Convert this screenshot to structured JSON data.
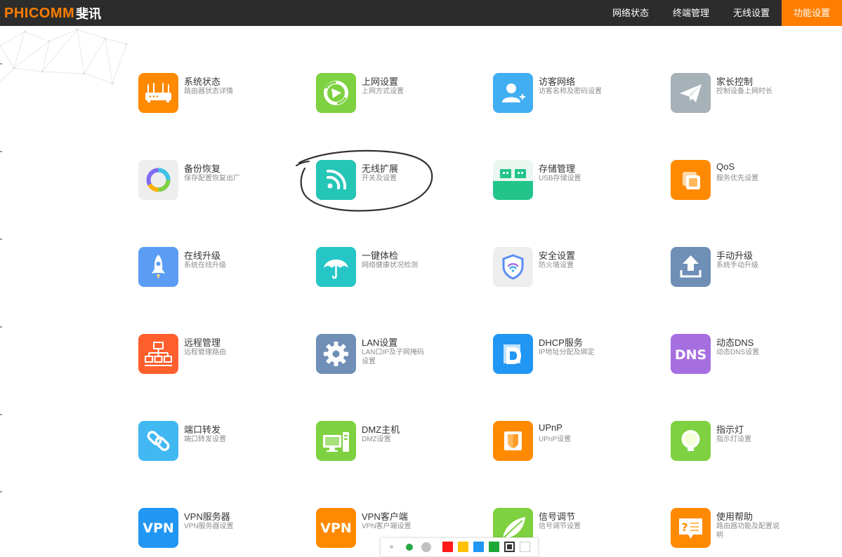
{
  "header": {
    "brand_en": "PHICOMM",
    "brand_cn": "斐讯",
    "nav": [
      {
        "label": "网络状态",
        "active": false
      },
      {
        "label": "终端管理",
        "active": false
      },
      {
        "label": "无线设置",
        "active": false
      },
      {
        "label": "功能设置",
        "active": true
      }
    ]
  },
  "colors": {
    "accent": "#ff7e00",
    "header_bg": "#2c2c2c",
    "annotation": "#333333"
  },
  "features": [
    {
      "title": "系统状态",
      "subtitle": "路由器状态详情",
      "icon": "router-icon",
      "color": "#ff8a00"
    },
    {
      "title": "上网设置",
      "subtitle": "上网方式设置",
      "icon": "internet-icon",
      "color": "#7ed140"
    },
    {
      "title": "访客网络",
      "subtitle": "访客名称及密码设置",
      "icon": "guest-user-icon",
      "color": "#41aef2"
    },
    {
      "title": "家长控制",
      "subtitle": "控制设备上网时长",
      "icon": "paper-plane-icon",
      "color": "#a7b1b8"
    },
    {
      "title": "备份恢复",
      "subtitle": "保存配置恢复出厂",
      "icon": "backup-ring-icon",
      "color": "#eeeeee"
    },
    {
      "title": "无线扩展",
      "subtitle": "开关及设置",
      "icon": "wifi-extend-icon",
      "color": "#26c6b7"
    },
    {
      "title": "存储管理",
      "subtitle": "USB存储设置",
      "icon": "usb-storage-icon",
      "color": "#22c48b"
    },
    {
      "title": "QoS",
      "subtitle": "服务优先设置",
      "icon": "qos-icon",
      "color": "#ff8a00"
    },
    {
      "title": "在线升级",
      "subtitle": "系统在线升级",
      "icon": "rocket-icon",
      "color": "#5b9df5"
    },
    {
      "title": "一键体检",
      "subtitle": "网络健康状况检测",
      "icon": "umbrella-icon",
      "color": "#26c6c6"
    },
    {
      "title": "安全设置",
      "subtitle": "防火墙设置",
      "icon": "shield-icon",
      "color": "#eeeeee"
    },
    {
      "title": "手动升级",
      "subtitle": "系统手动升级",
      "icon": "upload-icon",
      "color": "#6f8fb6"
    },
    {
      "title": "远程管理",
      "subtitle": "远程管理路由",
      "icon": "network-tree-icon",
      "color": "#ff5f2d"
    },
    {
      "title": "LAN设置",
      "subtitle": "LAN口IP及子网掩码设置",
      "icon": "gear-icon",
      "color": "#6f8fb6"
    },
    {
      "title": "DHCP服务",
      "subtitle": "IP地址分配及绑定",
      "icon": "dhcp-icon",
      "color": "#2196f3"
    },
    {
      "title": "动态DNS",
      "subtitle": "动态DNS设置",
      "icon": "dns-icon",
      "color": "#a66fe0"
    },
    {
      "title": "端口转发",
      "subtitle": "端口转发设置",
      "icon": "link-icon",
      "color": "#41b8f2"
    },
    {
      "title": "DMZ主机",
      "subtitle": "DMZ设置",
      "icon": "computer-icon",
      "color": "#7ed140"
    },
    {
      "title": "UPnP",
      "subtitle": "UPnP设置",
      "icon": "upnp-icon",
      "color": "#ff8a00"
    },
    {
      "title": "指示灯",
      "subtitle": "指示灯设置",
      "icon": "bulb-icon",
      "color": "#7ed140"
    },
    {
      "title": "VPN服务器",
      "subtitle": "VPN服务器设置",
      "icon": "vpn-server-icon",
      "color": "#2196f3"
    },
    {
      "title": "VPN客户端",
      "subtitle": "VPN客户端设置",
      "icon": "vpn-client-icon",
      "color": "#ff8a00"
    },
    {
      "title": "信号调节",
      "subtitle": "信号调节设置",
      "icon": "leaf-icon",
      "color": "#7ed140"
    },
    {
      "title": "使用帮助",
      "subtitle": "路由器功能及配置说明",
      "icon": "help-icon",
      "color": "#ff8a00"
    }
  ],
  "annotation_toolbar": {
    "tools": [
      {
        "name": "small-dot",
        "color": "#c8c8c8"
      },
      {
        "name": "medium-dot",
        "color": "#28a745"
      },
      {
        "name": "large-dot",
        "color": "#c0c0c0"
      },
      {
        "name": "red",
        "color": "#ff1a1a"
      },
      {
        "name": "yellow",
        "color": "#ffc000"
      },
      {
        "name": "blue",
        "color": "#2196f3"
      },
      {
        "name": "green",
        "color": "#1fa838"
      },
      {
        "name": "black",
        "color": "#333333"
      },
      {
        "name": "white",
        "color": "#ffffff"
      }
    ]
  }
}
